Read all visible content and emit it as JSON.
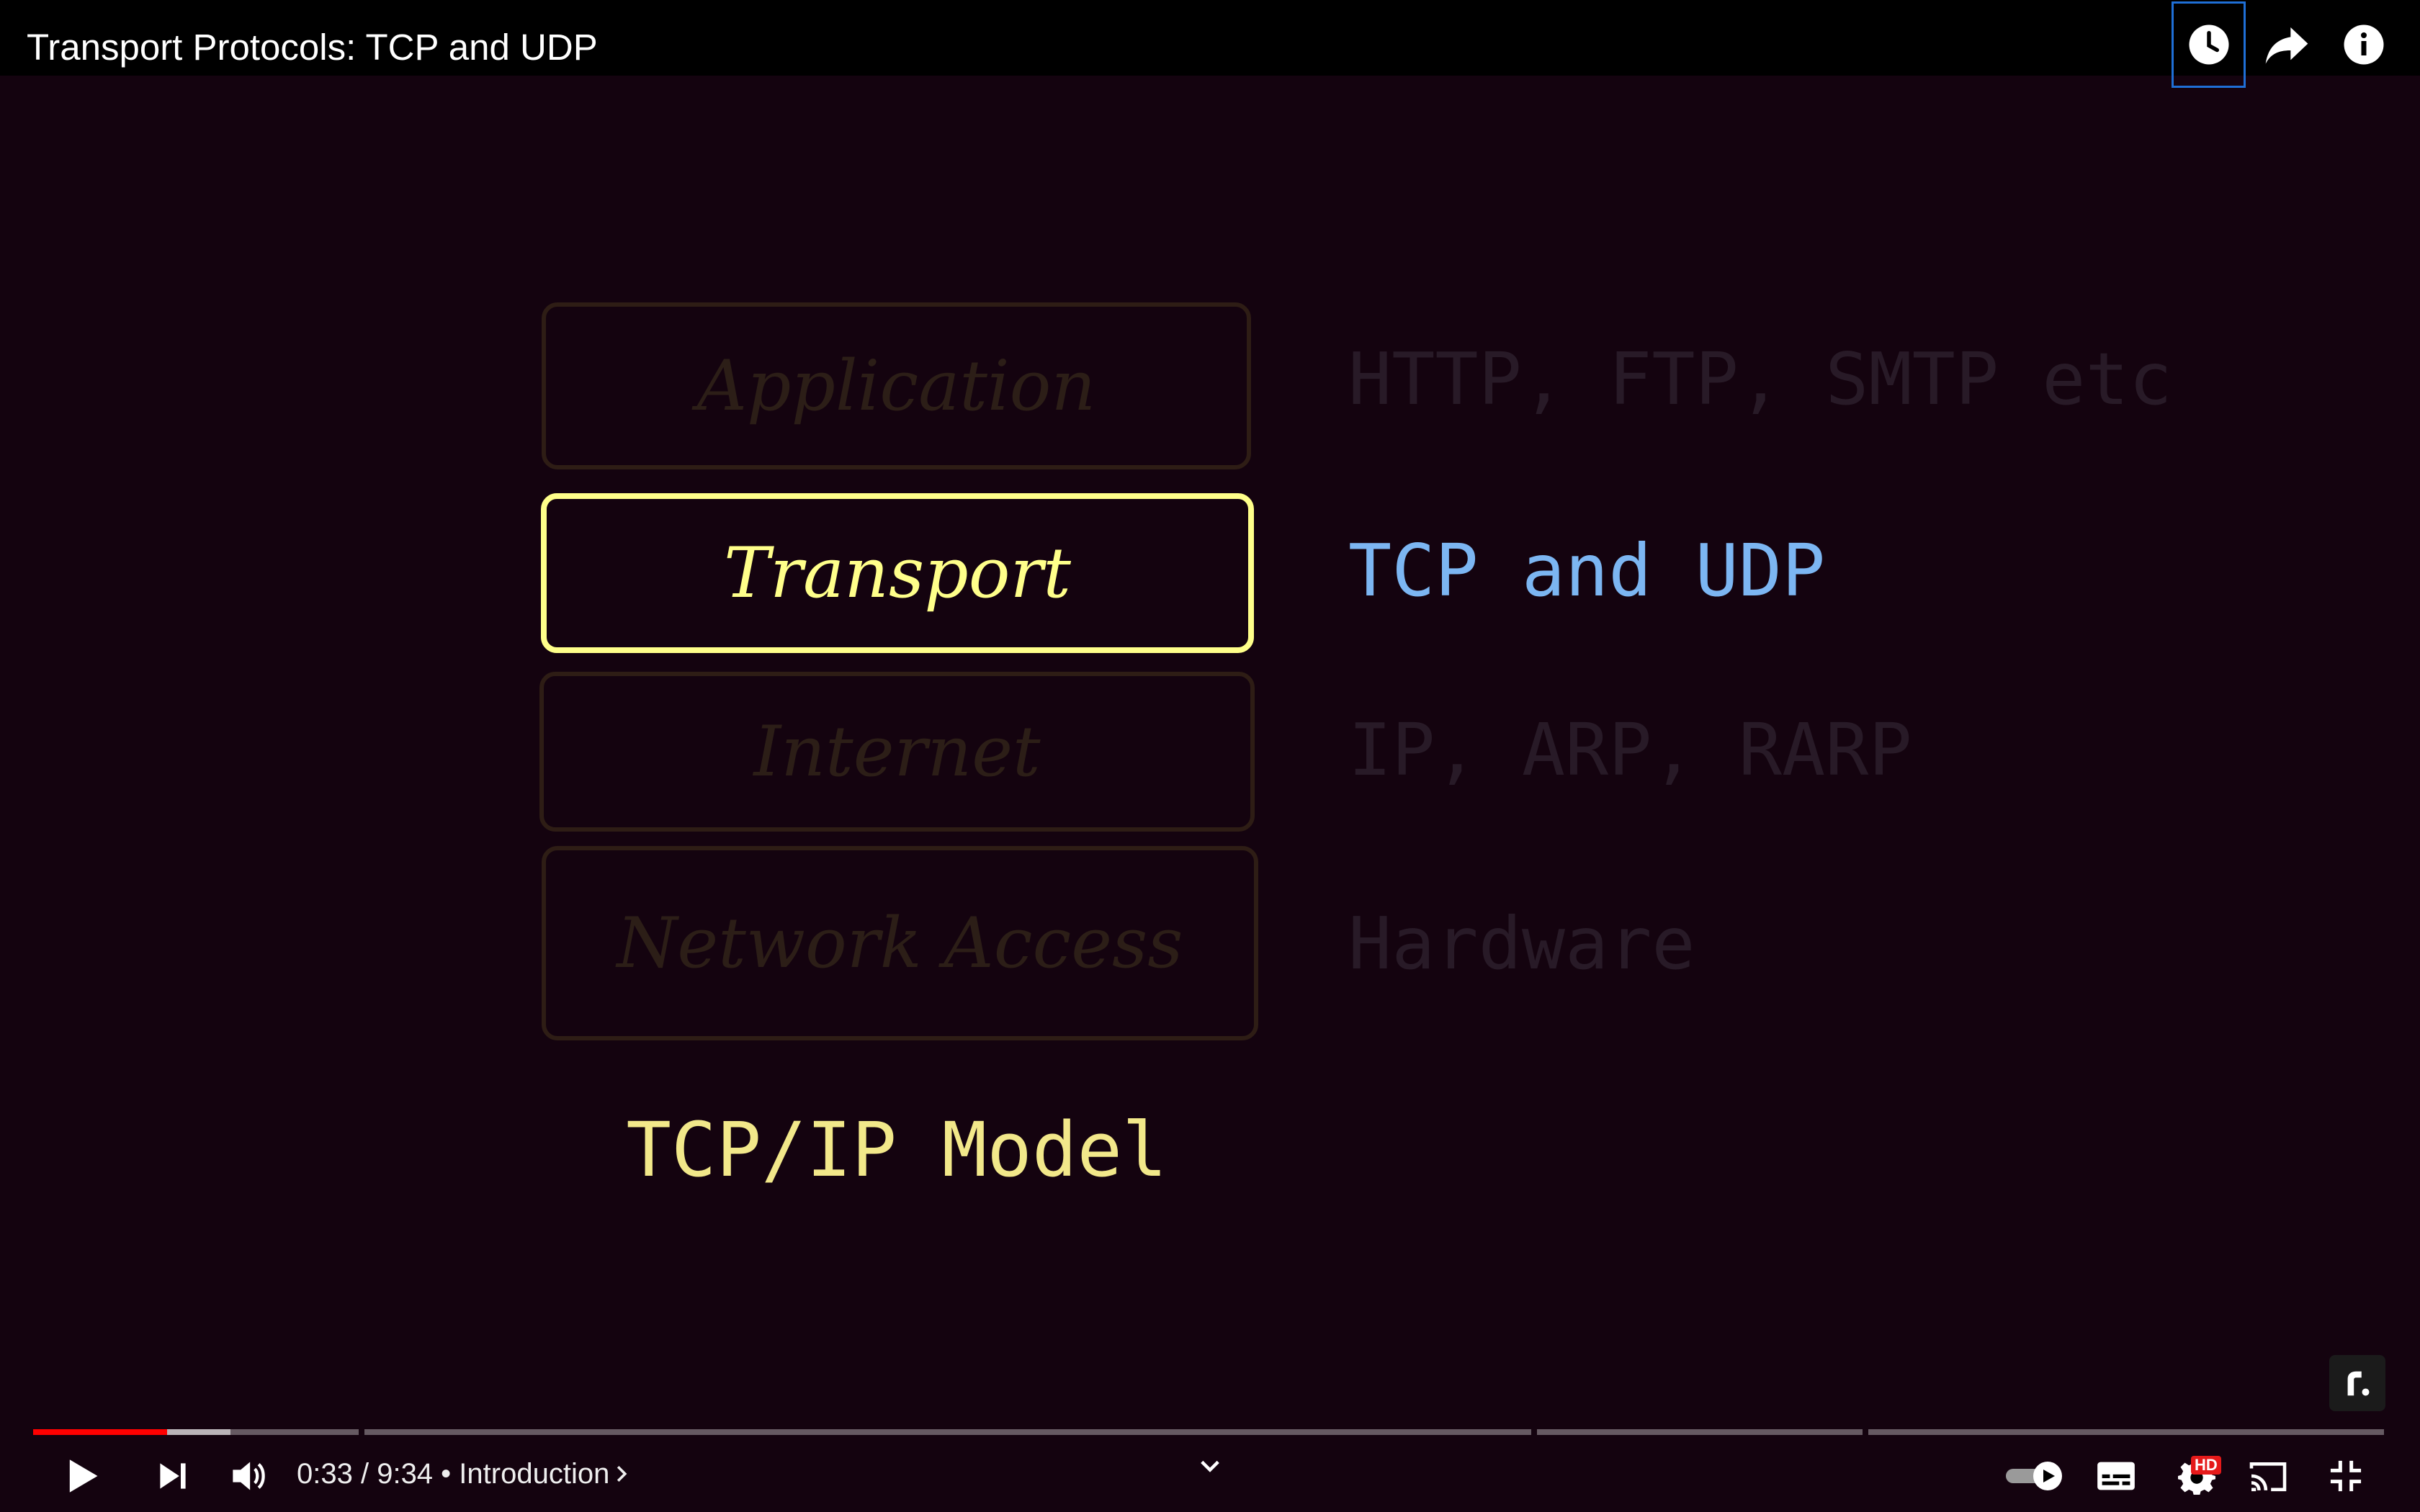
{
  "player": {
    "title": "Transport Protocols: TCP and UDP"
  },
  "slide": {
    "layers": [
      {
        "name": "Application",
        "protocols": "HTTP, FTP, SMTP etc",
        "highlighted": false
      },
      {
        "name": "Transport",
        "protocols": "TCP and UDP",
        "highlighted": true
      },
      {
        "name": "Internet",
        "protocols": "IP, ARP, RARP",
        "highlighted": false
      },
      {
        "name": "Network Access",
        "protocols": "Hardware",
        "highlighted": false
      }
    ],
    "caption": "TCP/IP Model",
    "colors": {
      "background": "#14030f",
      "highlight_box": "#ffff8a",
      "highlight_text": "#7cb6f2",
      "caption": "#f2e88a",
      "dimmed": "#2c1e17"
    }
  },
  "controls": {
    "current_time": "0:33",
    "duration": "9:34",
    "separator": " / ",
    "bullet": " • ",
    "chapter": "Introduction",
    "progress_fraction": 0.057,
    "buffered_fraction": 0.027,
    "hd_badge": "HD",
    "play_state": "paused",
    "autoplay": "on",
    "icons": [
      "play-icon",
      "next-icon",
      "volume-icon",
      "chevron-down-icon",
      "autoplay-toggle-icon",
      "subtitles-icon",
      "settings-gear-icon",
      "cast-icon",
      "exit-fullscreen-icon",
      "watch-later-icon",
      "share-icon",
      "info-icon"
    ]
  }
}
